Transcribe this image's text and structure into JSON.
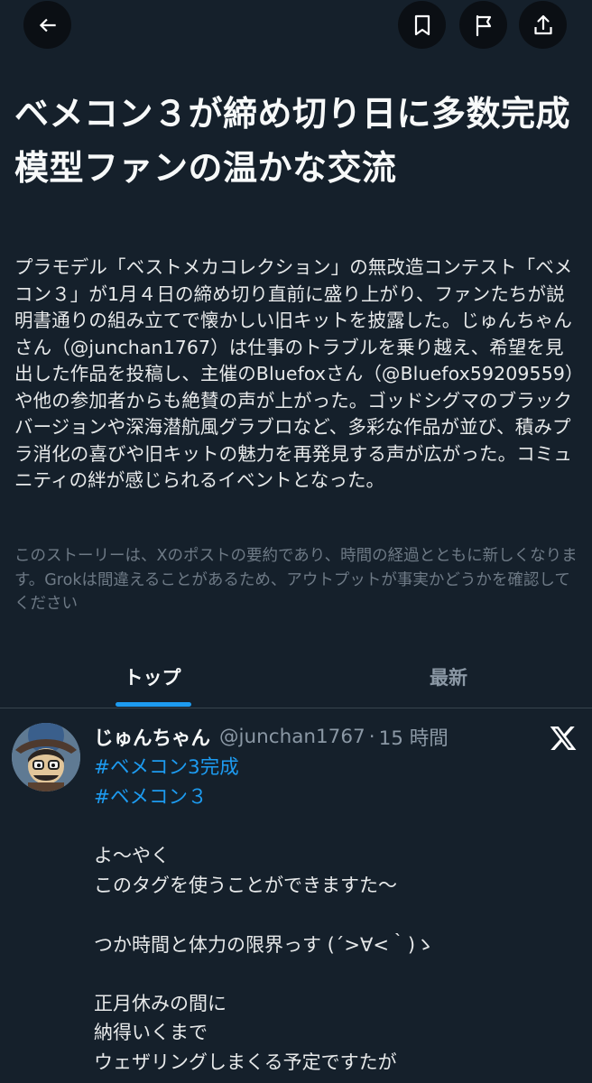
{
  "topbar": {
    "back_icon": "arrow-left-icon",
    "bookmark_icon": "bookmark-icon",
    "report_icon": "flag-icon",
    "share_icon": "share-upload-icon"
  },
  "story": {
    "headline": "ベメコン３が締め切り日に多数完成 模型ファンの温かな交流",
    "summary": "プラモデル「ベストメカコレクション」の無改造コンテスト「ベメコン３」が1月４日の締め切り直前に盛り上がり、ファンたちが説明書通りの組み立てで懐かしい旧キットを披露した。じゅんちゃんさん（@junchan1767）は仕事のトラブルを乗り越え、希望を見出した作品を投稿し、主催のBluefoxさん（@Bluefox59209559）や他の参加者からも絶賛の声が上がった。ゴッドシグマのブラックバージョンや深海潜航風グラブロなど、多彩な作品が並び、積みプラ消化の喜びや旧キットの魅力を再発見する声が広がった。コミュニティの絆が感じられるイベントとなった。",
    "disclaimer": "このストーリーは、Xのポストの要約であり、時間の経過とともに新しくなります。Grokは間違えることがあるため、アウトプットが事実かどうかを確認してください"
  },
  "tabs": {
    "top": "トップ",
    "latest": "最新",
    "active": "top"
  },
  "post": {
    "author_name": "じゅんちゃん",
    "handle": "@junchan1767",
    "separator": "·",
    "time": "15 時間",
    "source_icon": "x-logo-icon",
    "hashtags": [
      "#ベメコン3完成",
      "#ベメコン３"
    ],
    "lines": [
      "よ～やく",
      "このタグを使うことができますた～",
      "",
      "つか時間と体力の限界っす (´>∀<｀)ゝ",
      "",
      "正月休みの間に",
      "納得いくまで",
      "ウェザリングしまくる予定ですたが"
    ]
  },
  "colors": {
    "background": "#15202b",
    "button_background": "#0b0f14",
    "accent": "#1d9bf0",
    "text_primary": "#e7e9ea",
    "text_secondary": "#8b98a5",
    "divider": "#38444d"
  }
}
